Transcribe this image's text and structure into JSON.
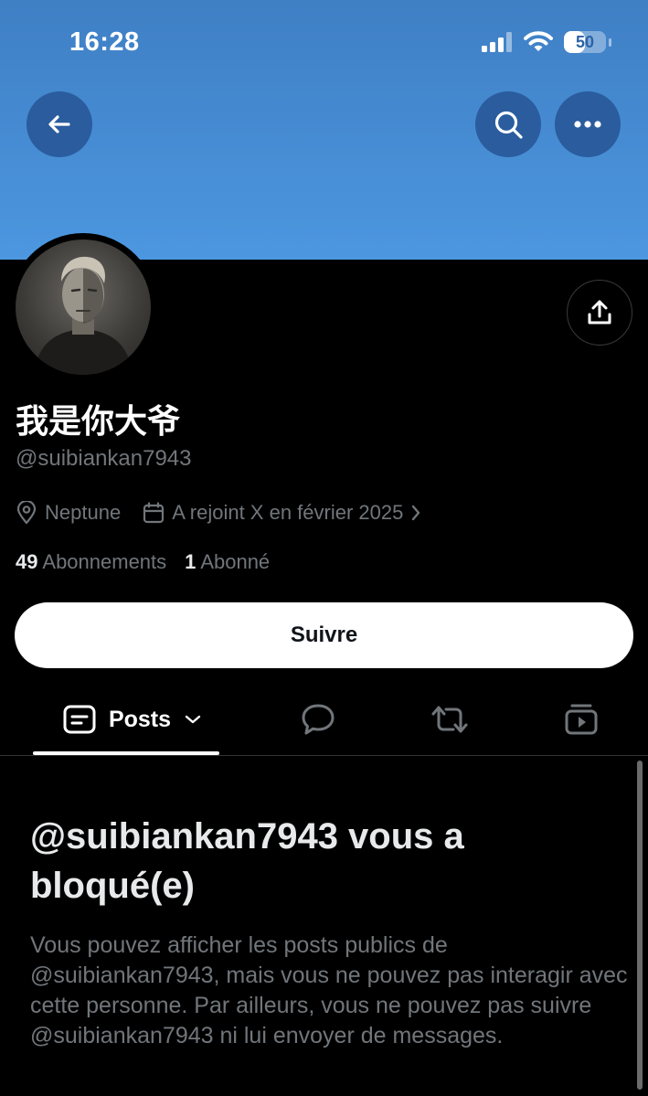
{
  "status_bar": {
    "time": "16:28",
    "battery": "50",
    "battery_level": 0.5,
    "icons": [
      "signal-icon",
      "wifi-icon",
      "battery-icon"
    ]
  },
  "header": {
    "back_icon": "back-arrow-icon",
    "search_icon": "search-icon",
    "more_icon": "more-icon"
  },
  "profile": {
    "display_name": "我是你大爷",
    "handle": "@suibiankan7943",
    "location": "Neptune",
    "joined": "A rejoint X en février 2025",
    "following_count": "49",
    "following_label": "Abonnements",
    "followers_count": "1",
    "followers_label": "Abonné",
    "follow_button": "Suivre"
  },
  "tabs": {
    "posts_label": "Posts",
    "icons": [
      "posts-icon",
      "reply-icon",
      "repost-icon",
      "media-icon"
    ]
  },
  "blocked": {
    "title": "@suibiankan7943 vous a bloqué(e)",
    "body": "Vous pouvez afficher les posts publics de @suibiankan7943, mais vous ne pouvez pas interagir avec cette personne. Par ailleurs, vous ne pouvez pas suivre @suibiankan7943 ni lui envoyer de messages."
  },
  "colors": {
    "banner": "#4c97e0",
    "background": "#000000",
    "secondary_text": "#71767b",
    "circle_button": "#2a5c9e"
  }
}
